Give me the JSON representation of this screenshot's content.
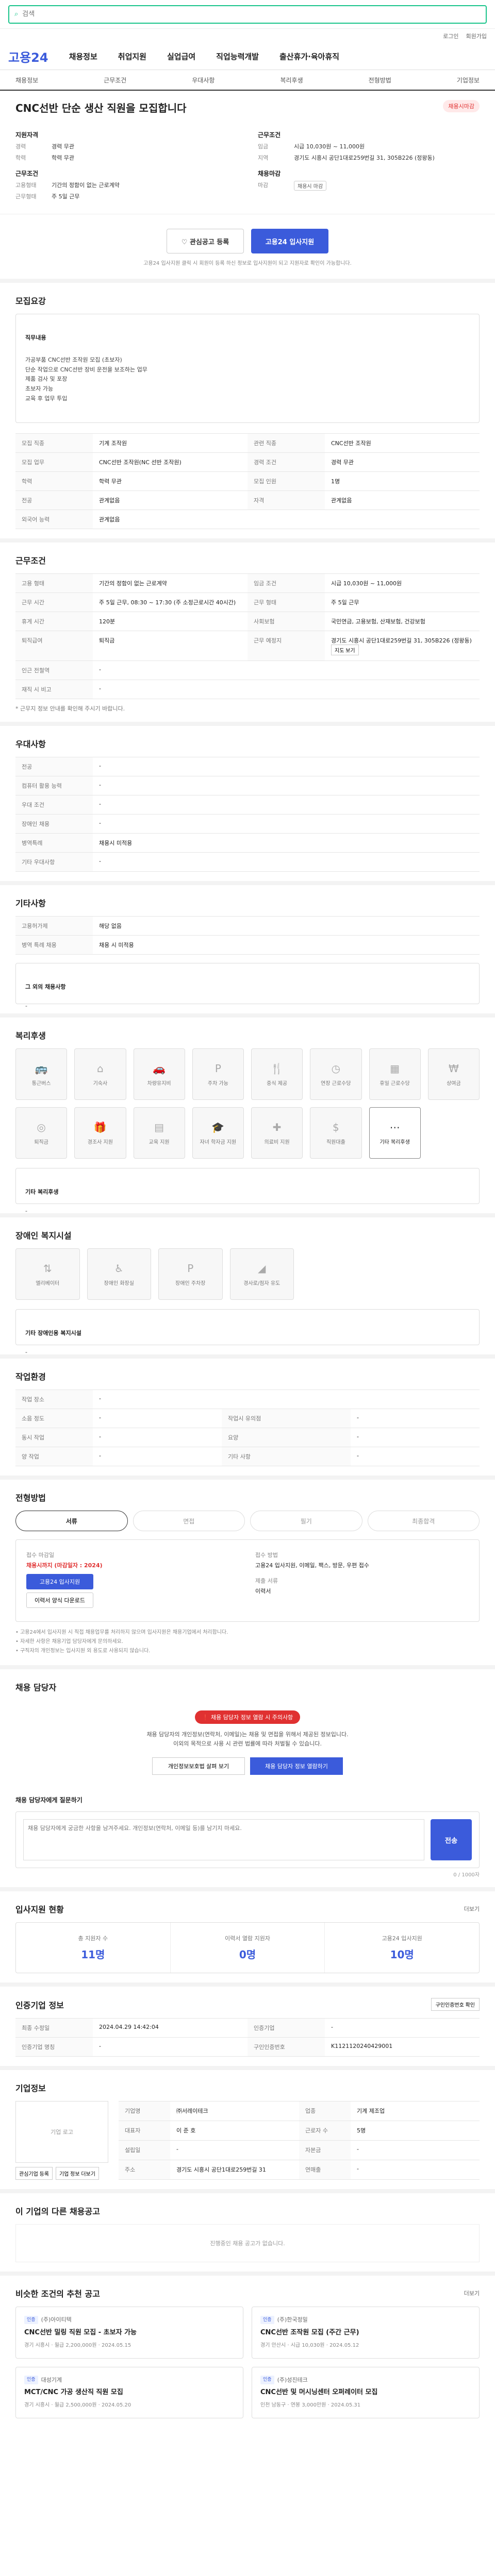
{
  "topbar": {
    "search_placeholder": "검색"
  },
  "util": {
    "links": [
      "로그인",
      "회원가입"
    ]
  },
  "gnb": {
    "logo": "고용24",
    "menus": [
      "채용정보",
      "취업지원",
      "실업급여",
      "직업능력개발",
      "출산휴가·육아휴직"
    ]
  },
  "subnav": {
    "items": [
      "채용정보",
      "근무조건",
      "우대사항",
      "복리후생",
      "전형방법",
      "기업정보"
    ]
  },
  "job": {
    "title": "CNC선반 단순 생산 직원을 모집합니다",
    "tag": "채용시마감",
    "left_title": "지원자격",
    "left": [
      {
        "k": "경력",
        "v": "경력 무관"
      },
      {
        "k": "학력",
        "v": "학력 무관"
      }
    ],
    "left2_title": "근무조건",
    "left2": [
      {
        "k": "고용형태",
        "v": "기간의 정함이 없는 근로계약"
      },
      {
        "k": "근무형태",
        "v": "주 5일 근무"
      }
    ],
    "right_title": "근무조건",
    "right": [
      {
        "k": "임금",
        "v": "시급 10,030원 ~ 11,000원"
      },
      {
        "k": "지역",
        "v": "경기도 시흥시 공단1대로259번길 31, 305B226 (정왕동)"
      }
    ],
    "right2_title": "채용마감",
    "right2": [
      {
        "k": "마감",
        "v": "채용시 마감"
      }
    ],
    "scrap": "관심공고 등록",
    "apply": "고용24 입사지원",
    "note": "고용24 입사지원 클릭 시 회원이 등록 하신 정보로 입사지원이 되고 지원자로 확인이 가능합니다."
  },
  "detail": {
    "title": "모집요강",
    "role_title": "직무내용",
    "role": "가공부품 CNC선반 조작원 모집 (초보자)\n단순 작업으로 CNC선반 장비 운전을 보조하는 업무\n제품 검사 및 포장\n초보자 가능\n교육 후 업무 투입"
  },
  "recruit": {
    "rows": [
      [
        "모집 직종",
        "기계 조작원",
        "관련 직종",
        "CNC선반 조작원"
      ],
      [
        "모집 업무",
        "CNC선반 조작원(NC 선반 조작원)",
        "경력 조건",
        "경력 무관"
      ],
      [
        "학력",
        "학력 무관",
        "모집 인원",
        "1명"
      ],
      [
        "전공",
        "관계없음",
        "자격",
        "관계없음"
      ],
      [
        "외국어 능력",
        "관계없음",
        "",
        ""
      ]
    ]
  },
  "work": {
    "title": "근무조건",
    "rows": [
      [
        "고용 형태",
        "기간의 정함이 없는 근로계약",
        "임금 조건",
        "시급 10,030원 ~ 11,000원"
      ],
      [
        "근무 시간",
        "주 5일 근무, 08:30 ~ 17:30 (주 소정근로시간 40시간)",
        "근무 형태",
        "주 5일 근무"
      ],
      [
        "휴게 시간",
        "120분",
        "사회보험",
        "국민연금, 고용보험, 산재보험, 건강보험"
      ],
      [
        "퇴직급여",
        "퇴직금",
        "근무 예정지",
        "경기도 시흥시 공단1대로259번길 31, 305B226 (정왕동)"
      ],
      [
        "인근 전철역",
        "-",
        "",
        ""
      ],
      [
        "재직 시 비고",
        "-",
        "",
        ""
      ]
    ],
    "map_btn": "지도 보기",
    "note": "* 근무지 정보 안내를 확인해 주시기 바랍니다."
  },
  "prefer": {
    "title": "우대사항",
    "rows": [
      [
        "전공",
        "-"
      ],
      [
        "컴퓨터 활용 능력",
        "-"
      ],
      [
        "우대 조건",
        "-"
      ],
      [
        "장애인 채용",
        "-"
      ],
      [
        "병역특례",
        "채용시 미적용"
      ],
      [
        "기타 우대사항",
        "-"
      ]
    ]
  },
  "etc": {
    "title": "기타사항",
    "rows": [
      [
        "고용허가제",
        "해당 없음"
      ],
      [
        "병역 특례 채용",
        "채용 시 미적용"
      ]
    ],
    "other_title": "그 외의 채용사항",
    "other_value": "-"
  },
  "benefit": {
    "title": "복리후생",
    "items": [
      {
        "label": "통근버스",
        "icon": "bus-icon",
        "on": false
      },
      {
        "label": "기숙사",
        "icon": "home-icon",
        "on": false
      },
      {
        "label": "차량유지비",
        "icon": "car-icon",
        "on": false
      },
      {
        "label": "주차 가능",
        "icon": "parking-icon",
        "on": false
      },
      {
        "label": "중식 제공",
        "icon": "meal-icon",
        "on": false
      },
      {
        "label": "연장 근로수당",
        "icon": "clock-icon",
        "on": false
      },
      {
        "label": "휴일 근로수당",
        "icon": "calendar-icon",
        "on": false
      },
      {
        "label": "상여금",
        "icon": "bonus-icon",
        "on": false
      },
      {
        "label": "퇴직금",
        "icon": "coin-icon",
        "on": false
      },
      {
        "label": "경조사 지원",
        "icon": "gift-icon",
        "on": false
      },
      {
        "label": "교육 지원",
        "icon": "book-icon",
        "on": false
      },
      {
        "label": "자녀 학자금 지원",
        "icon": "cap-icon",
        "on": false
      },
      {
        "label": "의료비 지원",
        "icon": "medical-icon",
        "on": false
      },
      {
        "label": "직원대출",
        "icon": "loan-icon",
        "on": false
      },
      {
        "label": "기타 복리후생",
        "icon": "etc-icon",
        "on": true
      }
    ],
    "other_title": "기타 복리후생",
    "other_value": "-"
  },
  "disabled": {
    "title": "장애인 복지시설",
    "items": [
      {
        "label": "엘리베이터",
        "icon": "elevator-icon"
      },
      {
        "label": "장애인 화장실",
        "icon": "toilet-icon"
      },
      {
        "label": "장애인 주차장",
        "icon": "parking-icon"
      },
      {
        "label": "경사로/점자 유도",
        "icon": "ramp-icon"
      }
    ],
    "other_title": "기타 장애인용 복지시설",
    "other_value": "-"
  },
  "apply_method": {
    "title": "작업환경",
    "rows": [
      [
        "작업 장소",
        "-",
        "",
        ""
      ],
      [
        "소음 정도",
        "-",
        "작업시 유의점",
        "-"
      ],
      [
        "동시 작업",
        "-",
        "요양",
        "-"
      ],
      [
        "양 작업",
        "-",
        "기타 사항",
        "-"
      ]
    ]
  },
  "process": {
    "title": "전형방법",
    "steps": [
      "서류",
      "면접",
      "필기",
      "최종합격"
    ],
    "left_label": "접수 마감일",
    "left_value": "채용시까지 (마감일자 : 2024)",
    "btn1": "고용24 입사지원",
    "btn2": "이력서 양식 다운로드",
    "right_label": "접수 방법",
    "right_value": "고용24 입사지원, 이메일, 팩스, 방문, 우편 접수",
    "right_label2": "제출 서류",
    "right_value2": "이력서",
    "bullets": [
      "• 고용24에서 입사지원 시 직접 채용업무를 처리하지 않으며 입사지원은 채용기업에서 처리합니다.",
      "• 자세한 사항은 채용기업 담당자에게 문의하세요.",
      "• 구직자의 개인정보는 입사지원 외 용도로 사용되지 않습니다."
    ]
  },
  "contact": {
    "title": "채용 담당자",
    "pill": "채용 담당자 정보 열람 시 주의사항",
    "text": "채용 담당자의 개인정보(연락처, 이메일)는 채용 및 면접을 위해서 제공된 정보입니다.\n이외의 목적으로 사용 시 관련 법률에 따라 처벌될 수 있습니다.",
    "btn_a": "개인정보보호법 살펴 보기",
    "btn_b": "채용 담당자 정보 열람하기",
    "qa_title": "채용 담당자에게 질문하기",
    "qa_placeholder": "채용 담당자에게 궁금한 사항을 남겨주세요. 개인정보(연락처, 이메일 등)를 남기지 마세요.",
    "qa_count": "0 / 1000자",
    "qa_btn": "전송"
  },
  "stats": {
    "title": "입사지원 현황",
    "more": "더보기",
    "items": [
      {
        "label": "총 지원자 수",
        "value": "11명"
      },
      {
        "label": "이력서 열람 지원자",
        "value": "0명"
      },
      {
        "label": "고용24 입사지원",
        "value": "10명"
      }
    ]
  },
  "info": {
    "title": "인증기업 정보",
    "rows": [
      [
        "최종 수정일",
        "2024.04.29 14:42:04",
        "인증기업",
        "-"
      ],
      [
        "인증기업 명칭",
        "-",
        "구인인증번호",
        "K1121120240429001"
      ]
    ],
    "btn": "구인인증번호 확인"
  },
  "company": {
    "title": "기업정보",
    "logo": "기업 로고",
    "rows": [
      [
        "기업명",
        "㈜서레이테크",
        "업종",
        "기계 제조업"
      ],
      [
        "대표자",
        "이 준 호",
        "근로자 수",
        "5명"
      ],
      [
        "설립일",
        "-",
        "자본금",
        "-"
      ],
      [
        "주소",
        "경기도 시흥시 공단1대로259번길 31",
        "연매출",
        "-"
      ]
    ],
    "btn1": "관심기업 등록",
    "btn2": "기업 정보 더보기"
  },
  "same": {
    "title": "이 기업의 다른 채용공고",
    "empty": "진행중인 채용 공고가 없습니다."
  },
  "similar": {
    "title": "비슷한 조건의 추천 공고",
    "more": "더보기",
    "cards": [
      {
        "company": "(주)아이티텍",
        "title": "CNC선반 밀링 직원 모집 - 초보자 가능",
        "badge": "인증",
        "loc": "경기 시흥시",
        "salary": "월급 2,200,000원",
        "date": "2024.05.15"
      },
      {
        "company": "(주)한국정밀",
        "title": "CNC선반 조작원 모집 (주간 근무)",
        "badge": "인증",
        "loc": "경기 안산시",
        "salary": "시급 10,030원",
        "date": "2024.05.12"
      },
      {
        "company": "대성기계",
        "title": "MCT/CNC 가공 생산직 직원 모집",
        "badge": "인증",
        "loc": "경기 시흥시",
        "salary": "월급 2,500,000원",
        "date": "2024.05.20"
      },
      {
        "company": "(주)성진테크",
        "title": "CNC선반 및 머시닝센터 오퍼레이터 모집",
        "badge": "인증",
        "loc": "인천 남동구",
        "salary": "연봉 3,000만원",
        "date": "2024.05.31"
      }
    ]
  }
}
